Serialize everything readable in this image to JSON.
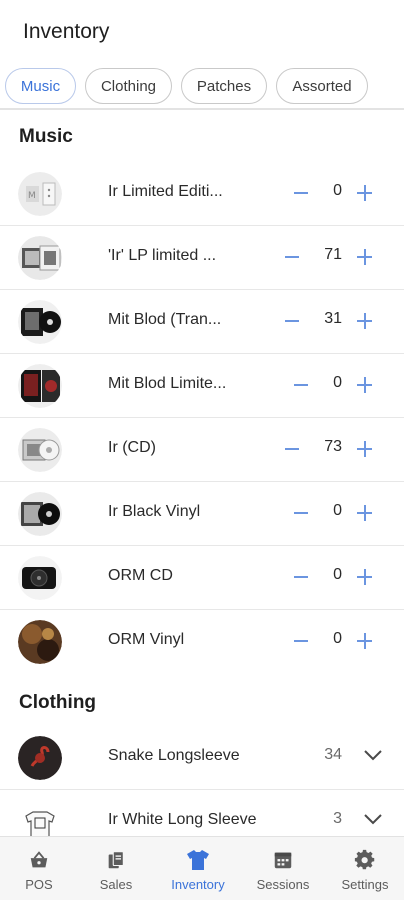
{
  "header": {
    "title": "Inventory"
  },
  "tabs": [
    {
      "label": "Music",
      "active": true
    },
    {
      "label": "Clothing",
      "active": false
    },
    {
      "label": "Patches",
      "active": false
    },
    {
      "label": "Assorted",
      "active": false
    }
  ],
  "sections": {
    "music": {
      "title": "Music",
      "items": [
        {
          "name": "Ir Limited Editi...",
          "qty": "0"
        },
        {
          "name": "'Ir' LP limited ...",
          "qty": "71"
        },
        {
          "name": "Mit Blod (Tran...",
          "qty": "31"
        },
        {
          "name": "Mit Blod Limite...",
          "qty": "0"
        },
        {
          "name": "Ir (CD)",
          "qty": "73"
        },
        {
          "name": "Ir Black Vinyl",
          "qty": "0"
        },
        {
          "name": "ORM CD",
          "qty": "0"
        },
        {
          "name": "ORM Vinyl",
          "qty": "0"
        }
      ]
    },
    "clothing": {
      "title": "Clothing",
      "items": [
        {
          "name": "Snake Longsleeve",
          "qty": "34"
        },
        {
          "name": "Ir White Long Sleeve",
          "qty": "3"
        }
      ]
    }
  },
  "bottom_nav": [
    {
      "label": "POS",
      "icon": "basket-icon",
      "active": false
    },
    {
      "label": "Sales",
      "icon": "receipts-icon",
      "active": false
    },
    {
      "label": "Inventory",
      "icon": "shirt-icon",
      "active": true
    },
    {
      "label": "Sessions",
      "icon": "calendar-icon",
      "active": false
    },
    {
      "label": "Settings",
      "icon": "gear-icon",
      "active": false
    }
  ],
  "colors": {
    "accent": "#3b73d9",
    "stepper": "#6b95e0",
    "nav_bg": "#f6f6f6"
  }
}
